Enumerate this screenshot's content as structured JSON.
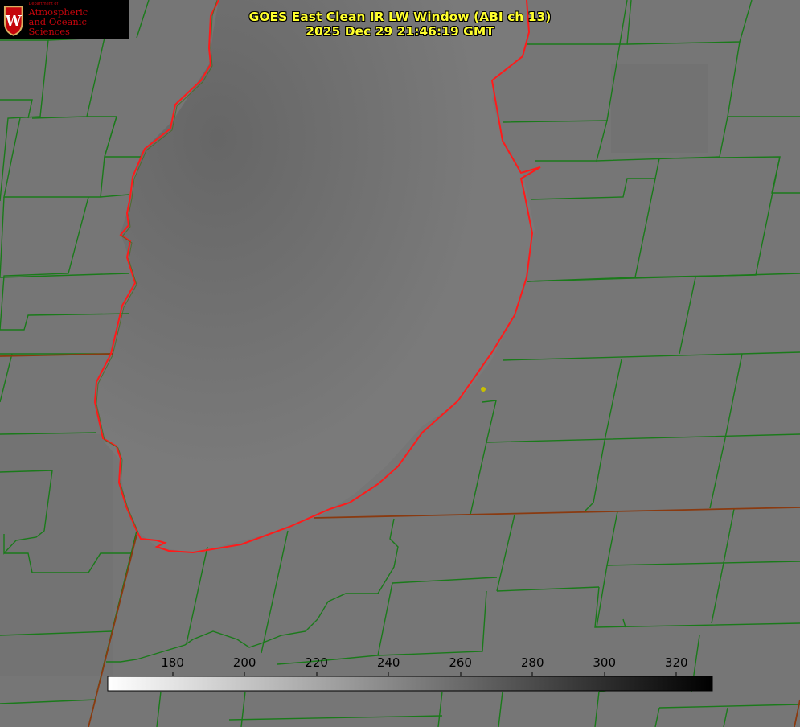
{
  "title": {
    "line1": "GOES East Clean IR LW Window (ABI ch 13)",
    "line2": "2025 Dec 29 21:46:19 GMT"
  },
  "logo": {
    "dept": "Department of",
    "line1": "Atmospheric",
    "line2": "and Oceanic Sciences",
    "icon": "uw-crest-icon"
  },
  "colorbar": {
    "min": 162,
    "max": 330,
    "ticks": [
      "180",
      "200",
      "220",
      "240",
      "260",
      "280",
      "300",
      "320"
    ],
    "color_low": "#ffffff",
    "color_high": "#000000"
  },
  "colors": {
    "background_gray": "#777777",
    "county_lines": "#1a7a1a",
    "coastline": "#ff1a1a",
    "title_text": "#ffff2e",
    "marker": "#c8c000"
  }
}
